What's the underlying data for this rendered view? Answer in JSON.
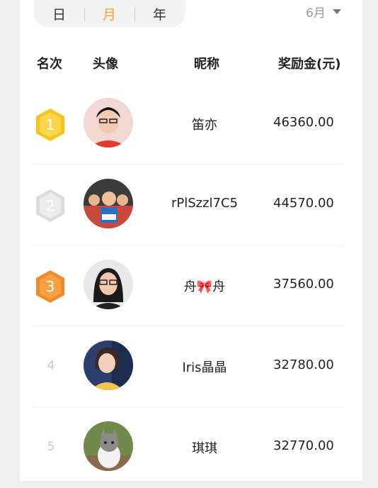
{
  "period_tabs": {
    "day": "日",
    "month": "月",
    "year": "年",
    "active": "月"
  },
  "month_selector": {
    "label": "6月"
  },
  "columns": {
    "rank": "名次",
    "avatar": "头像",
    "nickname": "昵称",
    "reward": "奖励金(元)"
  },
  "entries": [
    {
      "rank": "1",
      "medal": "gold-medal",
      "nickname": "笛亦",
      "reward": "46360.00"
    },
    {
      "rank": "2",
      "medal": "silver-medal",
      "nickname": "rPlSzzl7C5",
      "reward": "44570.00"
    },
    {
      "rank": "3",
      "medal": "bronze-medal",
      "nickname": "舟🎀舟",
      "reward": "37560.00"
    },
    {
      "rank": "4",
      "medal": "",
      "nickname": "Iris晶晶",
      "reward": "32780.00"
    },
    {
      "rank": "5",
      "medal": "",
      "nickname": "琪琪",
      "reward": "32770.00"
    }
  ],
  "colors": {
    "accent": "#f5a623",
    "gold": "#f6c21c",
    "silver": "#dcdcdc",
    "bronze": "#f08a2a"
  }
}
